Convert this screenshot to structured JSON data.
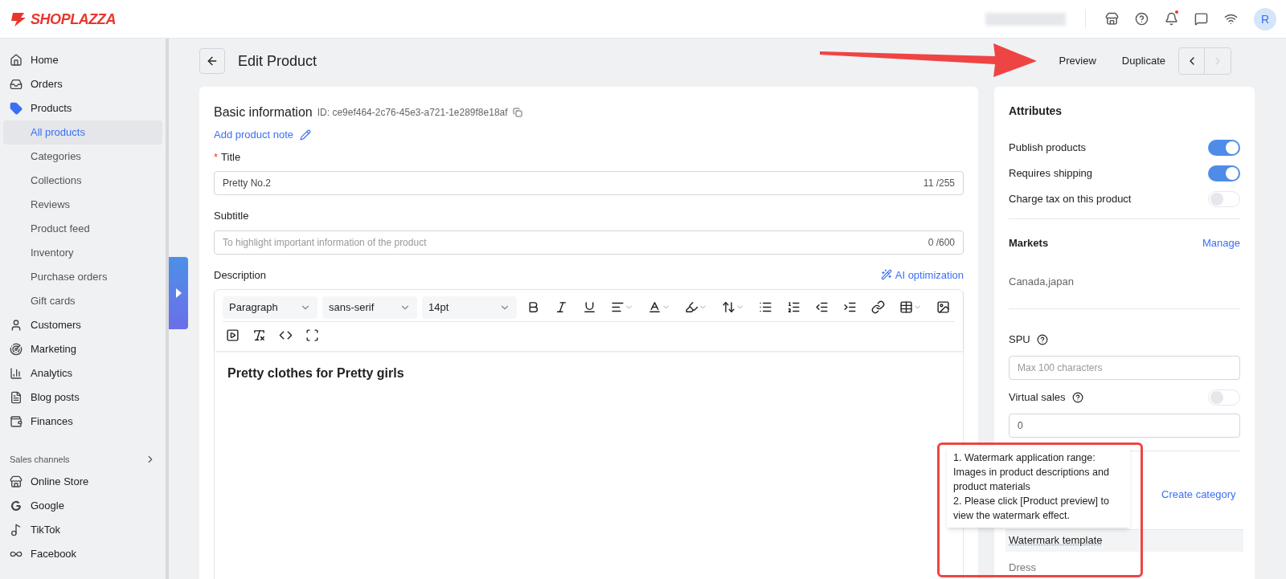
{
  "header": {
    "logo": "SHOPLAZZA",
    "notification_dot": true,
    "avatar": "R"
  },
  "sidebar": {
    "items": [
      {
        "label": "Home",
        "selected": false
      },
      {
        "label": "Orders",
        "selected": false
      },
      {
        "label": "Products",
        "selected": false,
        "expanded": true,
        "children": [
          {
            "label": "All products",
            "selected": true
          },
          {
            "label": "Categories",
            "selected": false
          },
          {
            "label": "Collections",
            "selected": false
          },
          {
            "label": "Reviews",
            "selected": false
          },
          {
            "label": "Product feed",
            "selected": false
          },
          {
            "label": "Inventory",
            "selected": false
          },
          {
            "label": "Purchase orders",
            "selected": false
          },
          {
            "label": "Gift cards",
            "selected": false
          }
        ]
      },
      {
        "label": "Customers",
        "selected": false
      },
      {
        "label": "Marketing",
        "selected": false
      },
      {
        "label": "Analytics",
        "selected": false
      },
      {
        "label": "Blog posts",
        "selected": false
      },
      {
        "label": "Finances",
        "selected": false
      }
    ],
    "section_title": "Sales channels",
    "channels": [
      {
        "label": "Online Store"
      },
      {
        "label": "Google"
      },
      {
        "label": "TikTok"
      },
      {
        "label": "Facebook"
      }
    ]
  },
  "page": {
    "title": "Edit Product",
    "actions": [
      "Preview",
      "Duplicate"
    ]
  },
  "basic": {
    "heading": "Basic information",
    "id_text": "ID: ce9ef464-2c76-45e3-a721-1e289f8e18af",
    "note_link": "Add product note",
    "required_mark": "*",
    "title_label": "Title",
    "title_value": "Pretty No.2",
    "title_count": "11 /255",
    "subtitle_label": "Subtitle",
    "subtitle_placeholder": "To highlight important information of the product",
    "subtitle_count": "0 /600",
    "description_label": "Description",
    "ai_link": "AI optimization",
    "selects": [
      "Paragraph",
      "sans-serif",
      "14pt"
    ],
    "content": "Pretty clothes for Pretty girls"
  },
  "attributes": {
    "heading": "Attributes",
    "toggles": [
      {
        "label": "Publish products",
        "on": true
      },
      {
        "label": "Requires shipping",
        "on": true
      },
      {
        "label": "Charge tax on this product",
        "on": false
      }
    ],
    "markets_heading": "Markets",
    "markets_link": "Manage",
    "markets_value": "Canada,japan",
    "spu_label": "SPU",
    "spu_placeholder": "Max 100 characters",
    "virtual_sales_label": "Virtual sales",
    "virtual_sales_on": false,
    "virtual_sales_value": "0",
    "create_category_link": "Create category",
    "tooltip": [
      "1. Watermark application range: Images in product descriptions and product materials",
      "2. Please click [Product preview] to view the watermark effect."
    ],
    "watermark_label": "Watermark template",
    "watermark_value": "Dress"
  }
}
